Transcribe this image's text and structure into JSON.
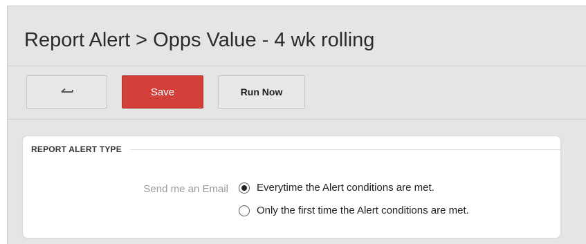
{
  "header": {
    "title": "Report Alert > Opps Value - 4 wk rolling"
  },
  "toolbar": {
    "back_icon": "back-arrow-icon",
    "save_label": "Save",
    "run_now_label": "Run Now"
  },
  "section": {
    "legend": "REPORT ALERT TYPE",
    "field_label": "Send me an Email",
    "options": [
      {
        "label": "Everytime the Alert conditions are met.",
        "checked": true
      },
      {
        "label": "Only the first time the Alert conditions are met.",
        "checked": false
      }
    ]
  },
  "colors": {
    "save_button": "#d2403a",
    "page_background": "#e5e5e5",
    "panel_background": "#ffffff"
  }
}
